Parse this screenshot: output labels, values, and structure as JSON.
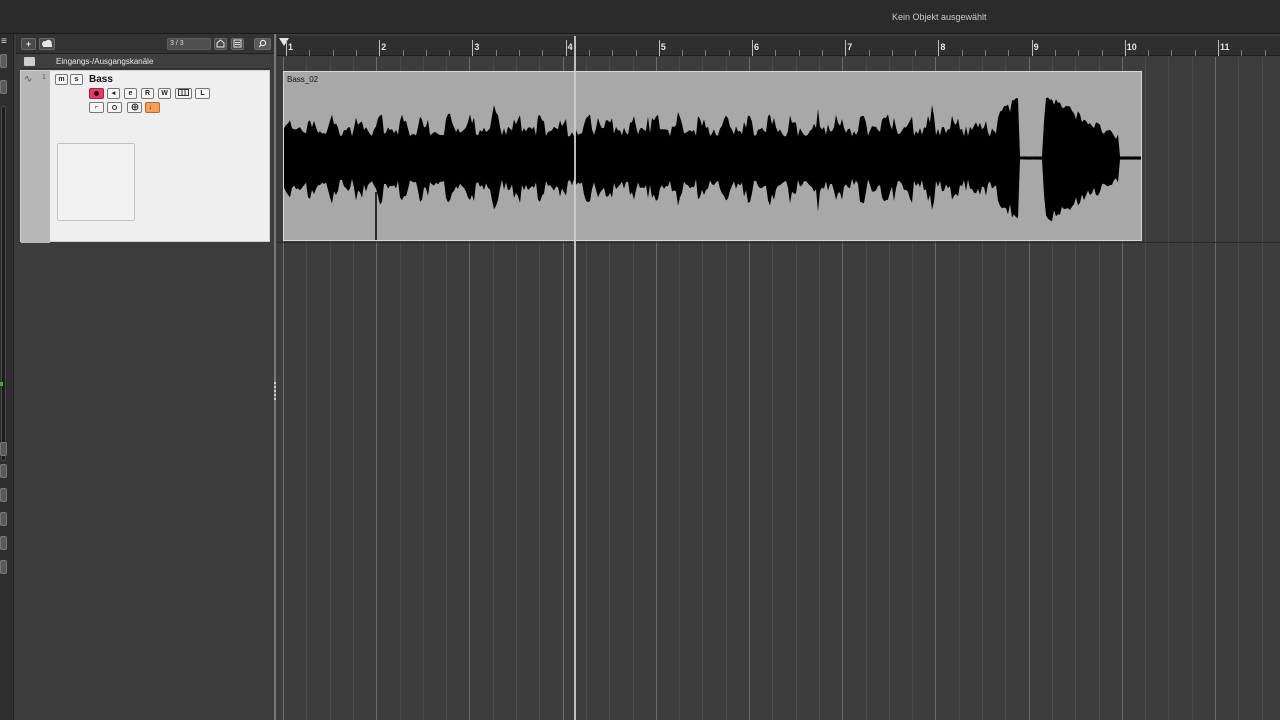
{
  "infoline": {
    "message": "Kein Objekt ausgewählt"
  },
  "tracklist": {
    "add_track_label": "+",
    "count": "3 / 3",
    "folder": {
      "label": "Eingangs-/Ausgangskanäle"
    },
    "track": {
      "number": "1",
      "name": "Bass",
      "mute_label": "m",
      "solo_label": "s",
      "read_label": "R",
      "write_label": "W",
      "lanes_label": "L",
      "monitor_label": "◂",
      "edit_label": "e",
      "lock_label": "⌐",
      "timebase_label": "♩"
    }
  },
  "ruler": {
    "bars": [
      "1",
      "2",
      "3",
      "4",
      "5",
      "6",
      "7",
      "8",
      "9",
      "10",
      "11"
    ]
  },
  "event": {
    "name": "Bass_02"
  },
  "colors": {
    "record_enabled": "#e8396b",
    "timebase_active": "#f2a05a",
    "event_background": "#a8a8a8",
    "waveform": "#000000"
  }
}
